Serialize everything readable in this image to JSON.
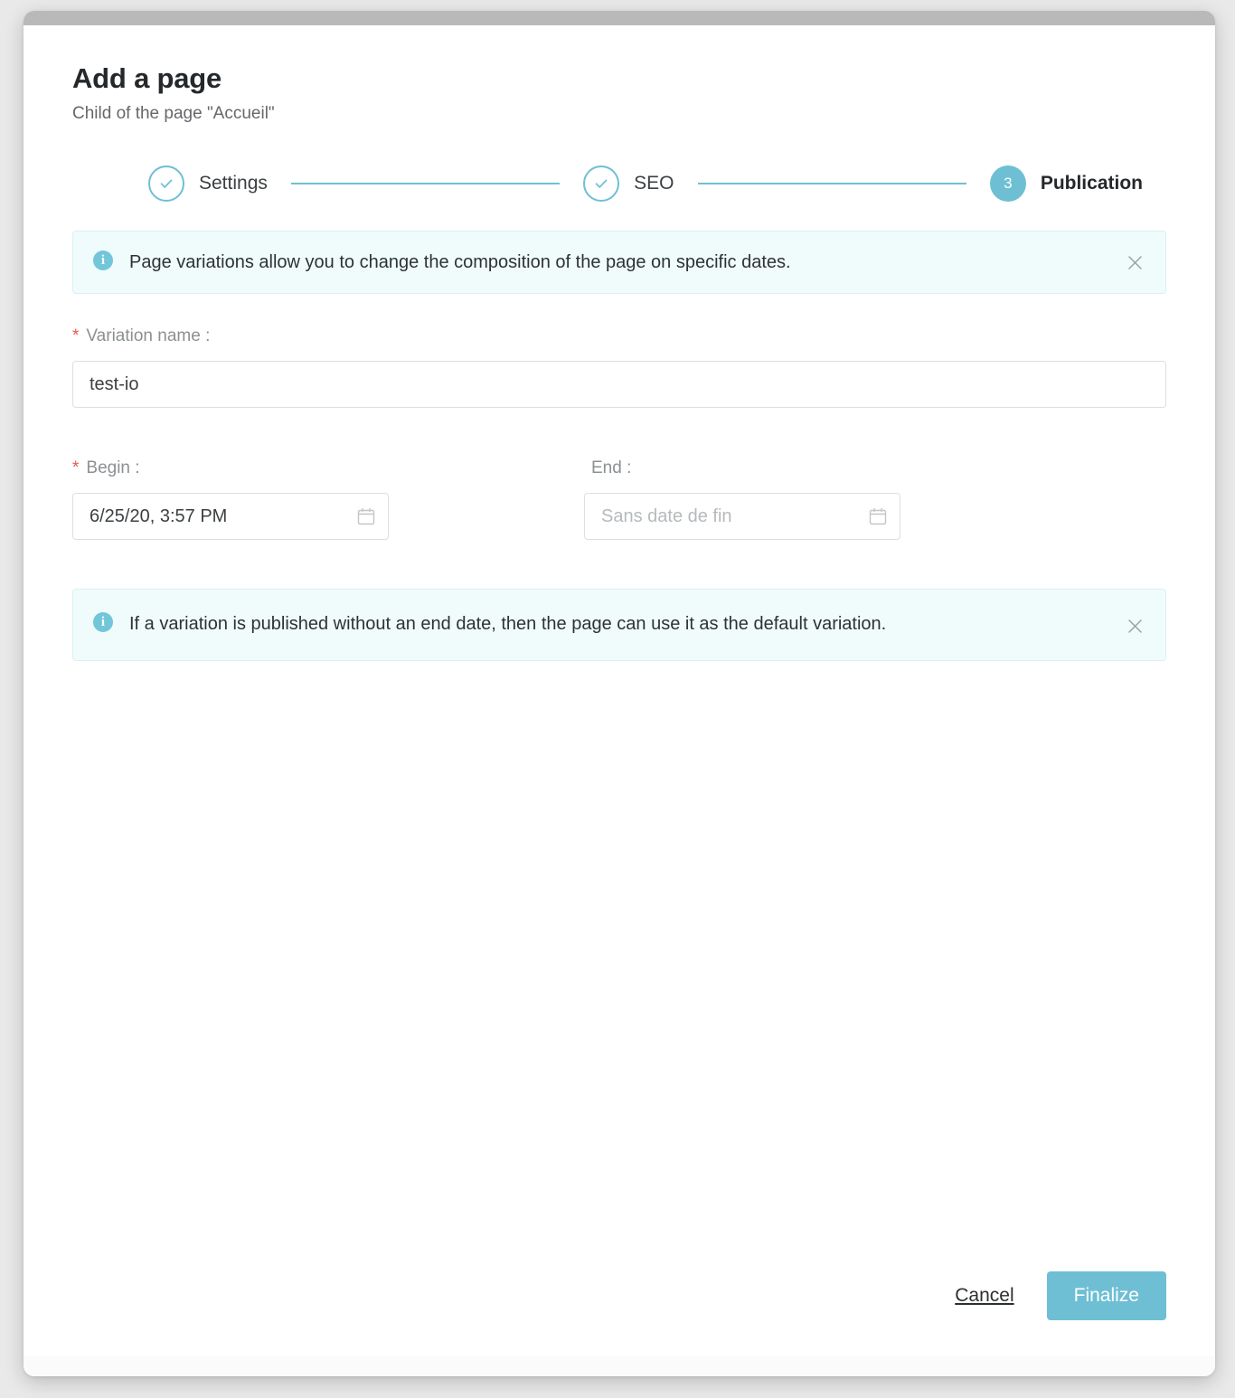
{
  "window": {
    "titlebar_color": "#b9b9b9",
    "accent_color": "#6ebfd4",
    "required_color": "#e8594f"
  },
  "header": {
    "title": "Add a page",
    "subtitle": "Child of the page \"Accueil\""
  },
  "stepper": {
    "steps": [
      {
        "label": "Settings",
        "state": "done",
        "marker": "check-icon"
      },
      {
        "label": "SEO",
        "state": "done",
        "marker": "check-icon"
      },
      {
        "label": "Publication",
        "state": "current",
        "marker": "3"
      }
    ]
  },
  "banners": [
    {
      "icon": "info-icon",
      "text": "Page variations allow you to change the composition of the page on specific dates.",
      "close_label": "✕"
    },
    {
      "icon": "info-icon",
      "text": "If a variation is published without an end date, then the page can use it as the default variation.",
      "close_label": "✕"
    }
  ],
  "form": {
    "variation_name": {
      "required_mark": "*",
      "label": "Variation name :",
      "value": "test-io",
      "placeholder": ""
    },
    "begin": {
      "required_mark": "*",
      "label": "Begin :",
      "value": "6/25/20, 3:57 PM",
      "placeholder": "",
      "icon": "calendar-icon"
    },
    "end": {
      "required_mark": "",
      "label": "End :",
      "value": "",
      "placeholder": "Sans date de fin",
      "icon": "calendar-icon"
    }
  },
  "footer": {
    "cancel_label": "Cancel",
    "finalize_label": "Finalize"
  }
}
